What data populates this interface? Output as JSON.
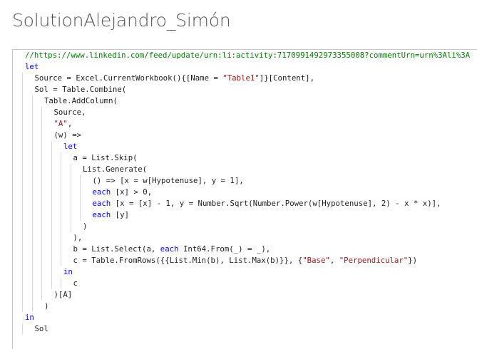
{
  "page": {
    "title": "SolutionAlejandro_Simón"
  },
  "editor": {
    "lines": [
      {
        "indent": 0,
        "tokens": [
          {
            "t": "//https://www.linkedin.com/feed/update/urn:li:activity:7170991492973355008?commentUrn=urn%3Ali%3A",
            "c": "cmt"
          }
        ]
      },
      {
        "indent": 0,
        "tokens": [
          {
            "t": "let",
            "c": "kw"
          }
        ]
      },
      {
        "indent": 1,
        "tokens": [
          {
            "t": "Source = Excel.CurrentWorkbook(){[Name = ",
            "c": ""
          },
          {
            "t": "\"Table1\"",
            "c": "str"
          },
          {
            "t": "]}[Content],",
            "c": ""
          }
        ]
      },
      {
        "indent": 1,
        "tokens": [
          {
            "t": "Sol = Table.Combine(",
            "c": ""
          }
        ]
      },
      {
        "indent": 2,
        "tokens": [
          {
            "t": "Table.AddColumn(",
            "c": ""
          }
        ]
      },
      {
        "indent": 3,
        "tokens": [
          {
            "t": "Source,",
            "c": ""
          }
        ]
      },
      {
        "indent": 3,
        "tokens": [
          {
            "t": "\"A\"",
            "c": "str"
          },
          {
            "t": ",",
            "c": ""
          }
        ]
      },
      {
        "indent": 3,
        "tokens": [
          {
            "t": "(w) =>",
            "c": ""
          }
        ]
      },
      {
        "indent": 4,
        "tokens": [
          {
            "t": "let",
            "c": "kw"
          }
        ]
      },
      {
        "indent": 5,
        "tokens": [
          {
            "t": "a = List.Skip(",
            "c": ""
          }
        ]
      },
      {
        "indent": 6,
        "tokens": [
          {
            "t": "List.Generate(",
            "c": ""
          }
        ]
      },
      {
        "indent": 7,
        "tokens": [
          {
            "t": "() => [x = w[Hypotenuse], y = 1],",
            "c": ""
          }
        ]
      },
      {
        "indent": 7,
        "tokens": [
          {
            "t": "each",
            "c": "kw"
          },
          {
            "t": " [x] > 0,",
            "c": ""
          }
        ]
      },
      {
        "indent": 7,
        "tokens": [
          {
            "t": "each",
            "c": "kw"
          },
          {
            "t": " [x = [x] - 1, y = Number.Sqrt(Number.Power(w[Hypotenuse], 2) - x * x)],",
            "c": ""
          }
        ]
      },
      {
        "indent": 7,
        "tokens": [
          {
            "t": "each",
            "c": "kw"
          },
          {
            "t": " [y]",
            "c": ""
          }
        ]
      },
      {
        "indent": 6,
        "tokens": [
          {
            "t": ")",
            "c": ""
          }
        ]
      },
      {
        "indent": 5,
        "tokens": [
          {
            "t": "),",
            "c": ""
          }
        ]
      },
      {
        "indent": 5,
        "tokens": [
          {
            "t": "b = List.Select(a, ",
            "c": ""
          },
          {
            "t": "each",
            "c": "kw"
          },
          {
            "t": " Int64.From(_) = _),",
            "c": ""
          }
        ]
      },
      {
        "indent": 5,
        "tokens": [
          {
            "t": "c = Table.FromRows({{List.Min(b), List.Max(b)}}, {",
            "c": ""
          },
          {
            "t": "\"Base\"",
            "c": "str"
          },
          {
            "t": ", ",
            "c": ""
          },
          {
            "t": "\"Perpendicular\"",
            "c": "str"
          },
          {
            "t": "})",
            "c": ""
          }
        ]
      },
      {
        "indent": 4,
        "tokens": [
          {
            "t": "in",
            "c": "kw"
          }
        ]
      },
      {
        "indent": 5,
        "tokens": [
          {
            "t": "c",
            "c": ""
          }
        ]
      },
      {
        "indent": 3,
        "tokens": [
          {
            "t": ")[A]",
            "c": ""
          }
        ]
      },
      {
        "indent": 2,
        "tokens": [
          {
            "t": ")",
            "c": ""
          }
        ]
      },
      {
        "indent": 0,
        "tokens": [
          {
            "t": "in",
            "c": "kw"
          }
        ]
      },
      {
        "indent": 1,
        "tokens": [
          {
            "t": "Sol",
            "c": ""
          }
        ]
      }
    ]
  },
  "colors": {
    "keyword": "#0000ff",
    "string": "#a31515",
    "comment": "#008000",
    "text": "#1e1e1e"
  }
}
